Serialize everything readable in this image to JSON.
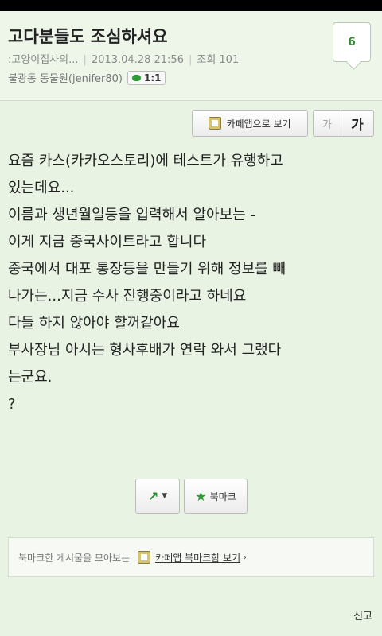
{
  "post": {
    "title": "고다분들도 조심하셔요",
    "author": ":고양이집사의...",
    "date": "2013.04.28 21:56",
    "views_label": "조회 101",
    "board": "불광동 동물원(jenifer80)",
    "chat_badge": "1:1",
    "comment_count": "6"
  },
  "toolbar": {
    "cafe_app_label": "카페앱으로 보기",
    "font_small": "가",
    "font_large": "가"
  },
  "content": {
    "lines": [
      "요즘 카스(카카오스토리)에 테스트가 유행하고",
      "있는데요...",
      "이름과 생년월일등을 입력해서 알아보는 -",
      "이게 지금 중국사이트라고 합니다",
      "중국에서 대포 통장등을 만들기 위해 정보를 빼",
      "나가는...지금 수사 진행중이라고 하네요",
      "다들 하지 않아야 할꺼같아요",
      "부사장님 아시는 형사후배가 연락 와서 그랬다",
      "는군요.",
      "?"
    ]
  },
  "actions": {
    "bookmark_label": "북마크"
  },
  "bookmark_bar": {
    "text": "북마크한 게시물을 모아보는",
    "link_label": "카페앱 북마크함 보기"
  },
  "footer": {
    "report_label": "신고"
  },
  "icons": {
    "share": "share-icon",
    "star": "star-icon",
    "cafe": "cafe-app-icon",
    "chat": "chat-bubble-icon"
  },
  "colors": {
    "background": "#e8f3e4",
    "accent_green": "#2f9a37"
  }
}
